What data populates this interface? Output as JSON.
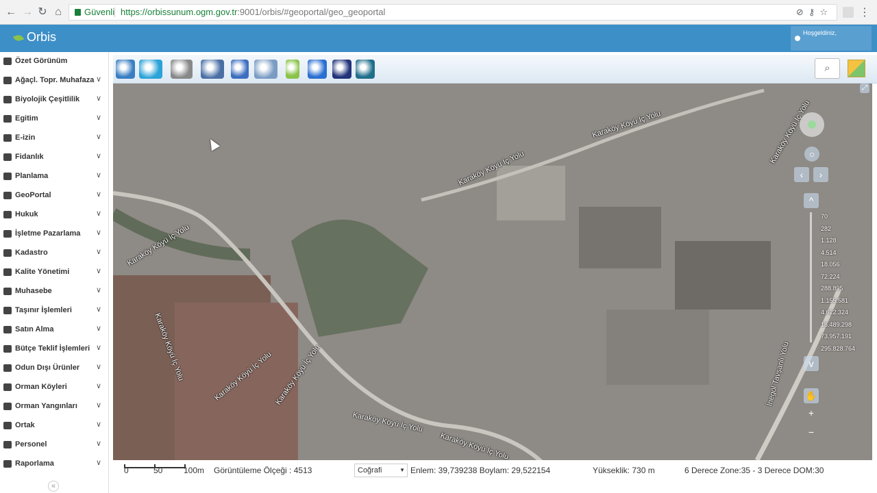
{
  "browser": {
    "secure_label": "Güvenli",
    "url_host": "https://orbissunum.ogm.gov.tr",
    "url_rest": ":9001/orbis/#geoportal/geo_geoportal"
  },
  "app": {
    "title": "Orbis",
    "welcome": "Hoşgeldiniz,"
  },
  "sidebar": {
    "items": [
      {
        "label": "Özet Görünüm",
        "expandable": false
      },
      {
        "label": "Ağaçl. Topr. Muhafaza",
        "expandable": true
      },
      {
        "label": "Biyolojik Çeşitlilik",
        "expandable": true
      },
      {
        "label": "Egitim",
        "expandable": true
      },
      {
        "label": "E-izin",
        "expandable": true
      },
      {
        "label": "Fidanlık",
        "expandable": true
      },
      {
        "label": "Planlama",
        "expandable": true
      },
      {
        "label": "GeoPortal",
        "expandable": true
      },
      {
        "label": "Hukuk",
        "expandable": true
      },
      {
        "label": "İşletme Pazarlama",
        "expandable": true
      },
      {
        "label": "Kadastro",
        "expandable": true
      },
      {
        "label": "Kalite Yönetimi",
        "expandable": true
      },
      {
        "label": "Muhasebe",
        "expandable": true
      },
      {
        "label": "Taşınır İşlemleri",
        "expandable": true
      },
      {
        "label": "Satın Alma",
        "expandable": true
      },
      {
        "label": "Bütçe Teklif İşlemleri",
        "expandable": true
      },
      {
        "label": "Odun Dışı Ürünler",
        "expandable": true
      },
      {
        "label": "Orman Köyleri",
        "expandable": true
      },
      {
        "label": "Orman Yangınları",
        "expandable": true
      },
      {
        "label": "Ortak",
        "expandable": true
      },
      {
        "label": "Personel",
        "expandable": true
      },
      {
        "label": "Raporlama",
        "expandable": true
      }
    ],
    "collapse_glyph": "«"
  },
  "toolbar": {
    "tools": [
      {
        "name": "layers-stack-icon",
        "color": "#3a7ec2"
      },
      {
        "name": "tools-icon",
        "color": "#2ba3d8"
      },
      {
        "name": "export-icon",
        "color": "#888888"
      },
      {
        "name": "print-icon",
        "color": "#4a6fa5"
      },
      {
        "name": "refresh-icon",
        "color": "#3d6fc0"
      },
      {
        "name": "table-icon",
        "color": "#7a9cc4"
      },
      {
        "name": "marker-icon",
        "color": "#8bc34a"
      },
      {
        "name": "globe-icon",
        "color": "#2a6fd1"
      },
      {
        "name": "split-view-icon",
        "color": "#22337a"
      },
      {
        "name": "tiles-icon",
        "color": "#1f6f8b"
      }
    ],
    "search_glyph": "⌕"
  },
  "map": {
    "road_labels": [
      {
        "text": "Karaköy Köyü İç Yolu"
      },
      {
        "text": "Karaköy Köyü İç Yolu"
      },
      {
        "text": "Karaköy Köyü İç Yolu"
      },
      {
        "text": "Karaköy Köyü İç Yolu"
      },
      {
        "text": "Karaköy Köyü İç Yolu"
      },
      {
        "text": "Karaköy Köyü İç Yolu"
      },
      {
        "text": "Karaköy Köyü İç Yolu"
      },
      {
        "text": "Karaköy Köyü İç Yolu"
      },
      {
        "text": "Karaköy Köyü İç Yolu"
      },
      {
        "text": "İnegöl Tavşanlı Yolu"
      }
    ],
    "zoom_levels": [
      "70",
      "282",
      "1.128",
      "4.514",
      "18.056",
      "72.224",
      "288.895",
      "1.155.581",
      "4.622.324",
      "18.489.298",
      "73.957.191",
      "295.828.764"
    ]
  },
  "status": {
    "scale_ticks": [
      "0",
      "50",
      "100m"
    ],
    "display_scale": "Görüntüleme Ölçeği : 4513",
    "coord_system": "Coğrafi",
    "latlon": "Enlem: 39,739238 Boylam: 29,522154",
    "elevation": "Yükseklik: 730 m",
    "zone": "6 Derece Zone:35 - 3 Derece DOM:30"
  }
}
